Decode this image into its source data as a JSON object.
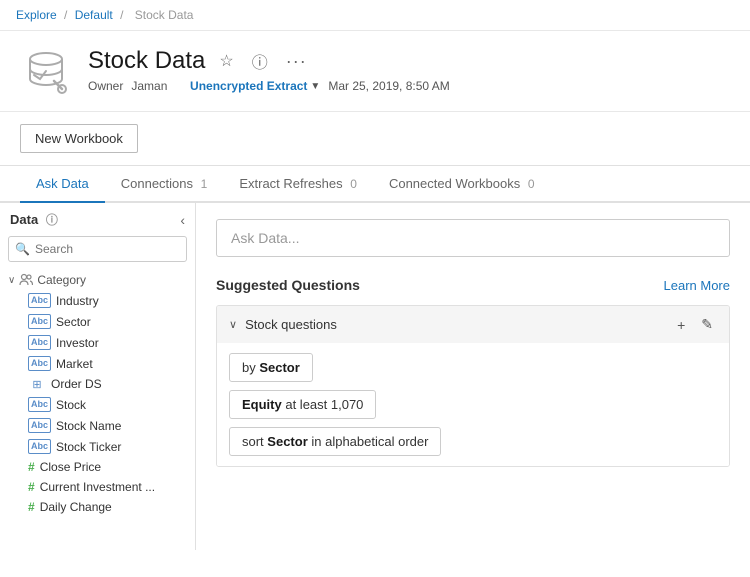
{
  "breadcrumb": {
    "explore": "Explore",
    "default": "Default",
    "current": "Stock Data",
    "sep": "/"
  },
  "header": {
    "title": "Stock Data",
    "owner_label": "Owner",
    "owner_name": "Jaman",
    "extract_label": "Unencrypted Extract",
    "date": "Mar 25, 2019, 8:50 AM",
    "star_icon": "★",
    "info_icon": "ⓘ",
    "more_icon": "•••"
  },
  "new_workbook": {
    "label": "New Workbook"
  },
  "tabs": [
    {
      "label": "Ask Data",
      "badge": "",
      "active": true
    },
    {
      "label": "Connections",
      "badge": "1",
      "active": false
    },
    {
      "label": "Extract Refreshes",
      "badge": "0",
      "active": false
    },
    {
      "label": "Connected Workbooks",
      "badge": "0",
      "active": false
    }
  ],
  "left_panel": {
    "title": "Data",
    "search_placeholder": "Search",
    "category": {
      "label": "Category",
      "fields": [
        {
          "type": "abc",
          "name": "Industry"
        },
        {
          "type": "abc",
          "name": "Sector"
        }
      ]
    },
    "fields": [
      {
        "type": "abc",
        "name": "Investor"
      },
      {
        "type": "abc",
        "name": "Market"
      },
      {
        "type": "calendar",
        "name": "Order DS"
      },
      {
        "type": "abc",
        "name": "Stock"
      },
      {
        "type": "abc",
        "name": "Stock Name"
      },
      {
        "type": "abc",
        "name": "Stock Ticker"
      },
      {
        "type": "hash",
        "name": "Close Price"
      },
      {
        "type": "hash",
        "name": "Current Investment ..."
      },
      {
        "type": "hash",
        "name": "Daily Change"
      }
    ]
  },
  "right_panel": {
    "ask_data_placeholder": "Ask Data...",
    "suggested_questions_title": "Suggested Questions",
    "learn_more": "Learn More",
    "accordion_title": "Stock questions",
    "questions": [
      {
        "text_parts": [
          {
            "text": "by ",
            "bold": false
          },
          {
            "text": "Sector",
            "bold": true
          }
        ]
      },
      {
        "text_parts": [
          {
            "text": "Equity",
            "bold": true
          },
          {
            "text": " at least 1,070",
            "bold": false
          }
        ]
      },
      {
        "text_parts": [
          {
            "text": "sort ",
            "bold": false
          },
          {
            "text": "Sector",
            "bold": true
          },
          {
            "text": " in alphabetical order",
            "bold": false
          }
        ]
      }
    ]
  },
  "icons": {
    "search": "🔍",
    "collapse": "‹",
    "chevron_down": "∨",
    "plus": "+",
    "edit": "✎",
    "info": "ⓘ"
  }
}
